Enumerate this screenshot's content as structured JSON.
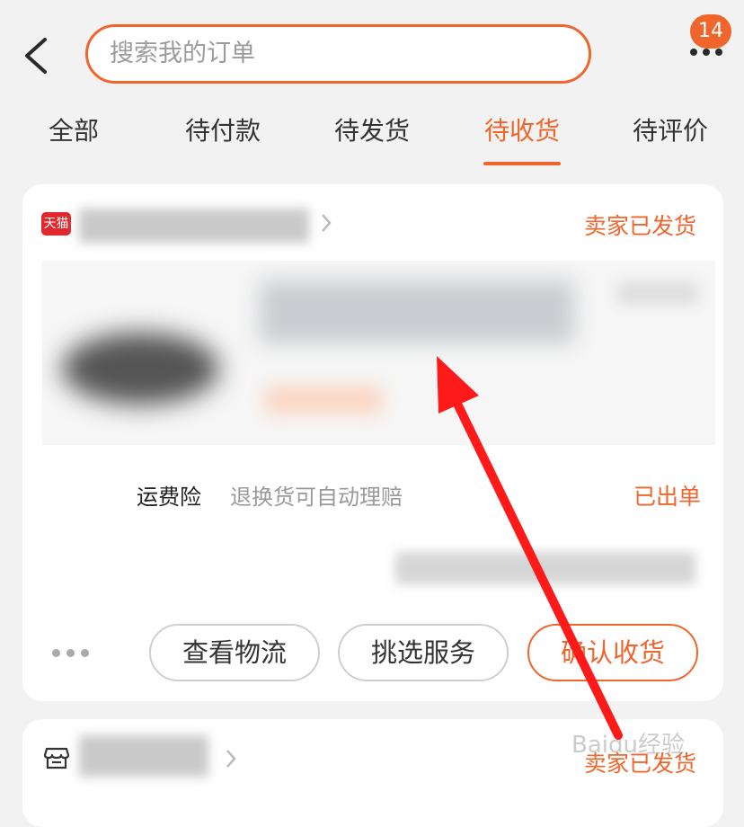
{
  "header": {
    "search_placeholder": "搜索我的订单",
    "badge_count": "14"
  },
  "tabs": [
    {
      "label": "全部",
      "active": false
    },
    {
      "label": "待付款",
      "active": false
    },
    {
      "label": "待发货",
      "active": false
    },
    {
      "label": "待收货",
      "active": true
    },
    {
      "label": "待评价",
      "active": false
    }
  ],
  "order": {
    "shop_badge": "天猫",
    "status": "卖家已发货",
    "insurance_label": "运费险",
    "insurance_desc": "退换货可自动理赔",
    "insurance_status": "已出单",
    "buttons": {
      "logistics": "查看物流",
      "service": "挑选服务",
      "confirm": "确认收货"
    }
  },
  "order2": {
    "status": "卖家已发货"
  },
  "watermark": {
    "text": "Baidu经验"
  },
  "colors": {
    "accent": "#f0652b",
    "annotation_arrow": "#ff1a1a"
  }
}
